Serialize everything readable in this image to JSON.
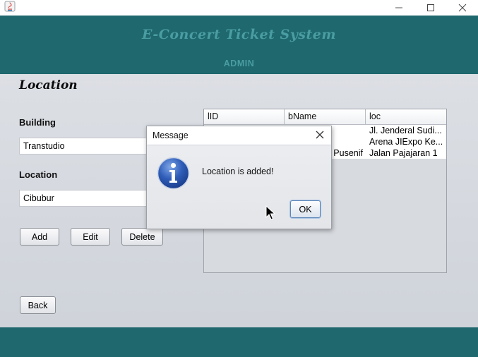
{
  "window": {
    "title": "",
    "icons": {
      "app": "java-icon",
      "minimize": "minimize-icon",
      "maximize": "maximize-icon",
      "close": "close-icon"
    }
  },
  "header": {
    "app_title": "E-Concert Ticket System",
    "role": "ADMIN",
    "background": "#1e686e",
    "text_color": "#4a9da2"
  },
  "form": {
    "page_title": "Location",
    "building_label": "Building",
    "building_value": "Transtudio",
    "location_label": "Location",
    "location_value": "Cibubur",
    "buttons": {
      "add": "Add",
      "edit": "Edit",
      "delete": "Delete",
      "back": "Back"
    }
  },
  "table": {
    "columns": [
      "lID",
      "bName",
      "loc"
    ],
    "rows": [
      [
        "",
        "",
        "Jl. Jenderal Sudi..."
      ],
      [
        "",
        "",
        "Arena JIExpo Ke..."
      ],
      [
        "",
        "Pusenif",
        "Jalan Pajajaran 1"
      ]
    ]
  },
  "dialog": {
    "title": "Message",
    "message": "Location is added!",
    "ok_label": "OK",
    "icon": "information-icon",
    "close_icon": "close-icon"
  },
  "cursor": "mouse-pointer-icon"
}
